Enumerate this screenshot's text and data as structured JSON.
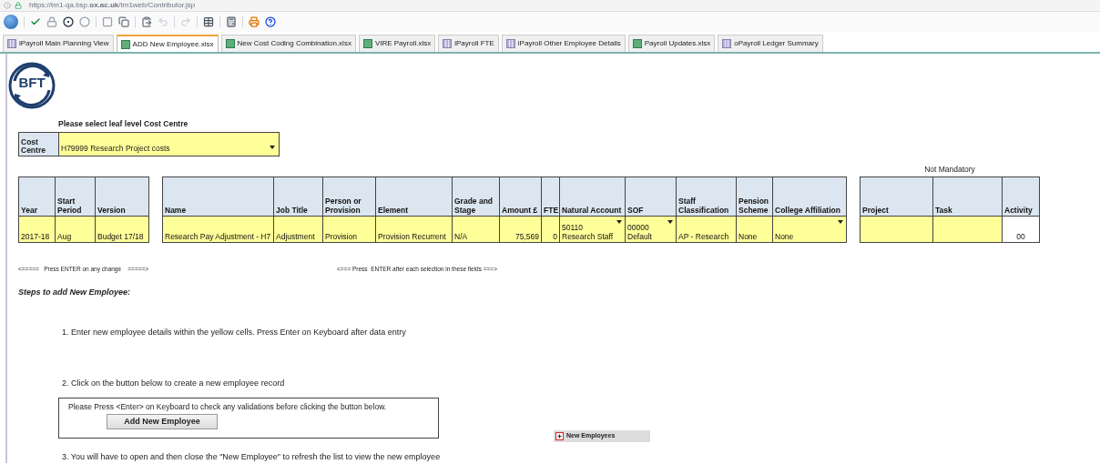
{
  "address_bar": {
    "url": "https://tm1-qa.bsp.**ox.ac.uk**/tm1web/Contributor.jsp"
  },
  "tabs": [
    {
      "label": "iPayroll Main Planning View",
      "kind": "view",
      "selected": false
    },
    {
      "label": "ADD New Employee.xlsx",
      "kind": "workbook",
      "selected": true
    },
    {
      "label": "New Cost Coding Combination.xlsx",
      "kind": "workbook",
      "selected": false
    },
    {
      "label": "VIRE Payroll.xlsx",
      "kind": "workbook",
      "selected": false
    },
    {
      "label": "iPayroll FTE",
      "kind": "view",
      "selected": false
    },
    {
      "label": "iPayroll Other Employee Details",
      "kind": "view",
      "selected": false
    },
    {
      "label": "Payroll Updates.xlsx",
      "kind": "workbook",
      "selected": false
    },
    {
      "label": "oPayroll Ledger Summary",
      "kind": "view",
      "selected": false
    }
  ],
  "logo": {
    "text": "BFT"
  },
  "cost_centre": {
    "prompt": "Please select leaf level Cost Centre",
    "label": "Cost Centre",
    "value": "H79999 Research Project costs"
  },
  "not_mandatory_label": "Not Mandatory",
  "tables": [
    {
      "columns": [
        "Year",
        "Start Period",
        "Version"
      ],
      "cells": [
        {
          "text": "2017-18",
          "kind": "text"
        },
        {
          "text": "Aug",
          "kind": "text"
        },
        {
          "text": "Budget 17/18",
          "kind": "text"
        }
      ]
    },
    {
      "columns": [
        "Name",
        "Job Title",
        "Person or Provision",
        "Element",
        "Grade and Stage",
        "Amount £",
        "FTE",
        "Natural Account",
        "SOF",
        "Staff Classification",
        "Pension Scheme",
        "College Affiliation"
      ],
      "cells": [
        {
          "text": "Research Pay Adjustment - H7",
          "kind": "text"
        },
        {
          "text": "Adjustment",
          "kind": "text"
        },
        {
          "text": "Provision",
          "kind": "text"
        },
        {
          "text": "Provision Recurrent",
          "kind": "text"
        },
        {
          "text": "N/A",
          "kind": "text"
        },
        {
          "text": "75,569",
          "kind": "number"
        },
        {
          "text": "0",
          "kind": "number"
        },
        {
          "text": "50110\nResearch Staff",
          "kind": "dropdown"
        },
        {
          "text": "00000\nDefault",
          "kind": "dropdown"
        },
        {
          "text": "AP - Research",
          "kind": "text"
        },
        {
          "text": "None",
          "kind": "text"
        },
        {
          "text": "None",
          "kind": "dropdown"
        }
      ]
    },
    {
      "columns": [
        "Project",
        "Task",
        "Activity"
      ],
      "cells": [
        {
          "kind": "text"
        },
        {
          "kind": "text"
        },
        {
          "text": "00",
          "kind": "readonly"
        }
      ]
    }
  ],
  "hints": [
    "<=====   Press ENTER on any change    =====>",
    "<=== Press  ENTER after each selection in these fields ===>"
  ],
  "steps_heading": "Steps to add New Employee:",
  "step_1": "1. Enter new employee details within the yellow cells.  Press Enter on Keyboard after data entry",
  "step_2": "2. Click on the button below to create a new employee record",
  "validation_note": "Please Press <Enter> on Keyboard to check any validations before clicking the button below.",
  "add_button": "Add New Employee",
  "step_3": "3. You will have to open and then close the \"New Employee\"  to refresh the list to view the new employee",
  "new_employees": {
    "label": "New Employees",
    "expanded": false
  }
}
